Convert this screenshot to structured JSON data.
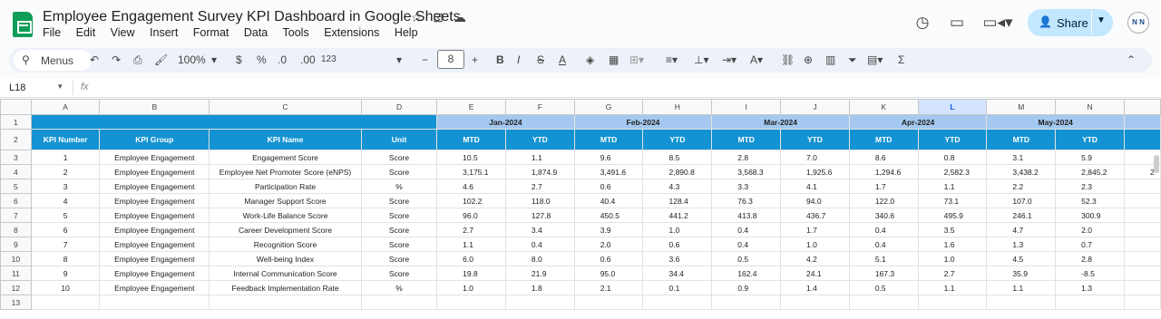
{
  "app": {
    "doc_title": "Employee Engagement Survey KPI Dashboard in Google Sheets",
    "menu": [
      "File",
      "Edit",
      "View",
      "Insert",
      "Format",
      "Data",
      "Tools",
      "Extensions",
      "Help"
    ],
    "share_label": "Share",
    "avatar_text": "N N"
  },
  "toolbar": {
    "search_label": "Menus",
    "zoom": "100%",
    "currency": "$",
    "percent": "%",
    "dec_less": ".0",
    "dec_more": ".00",
    "number_format": "123",
    "font_size": "8"
  },
  "formula_bar": {
    "cell_ref": "L18",
    "fx": "fx"
  },
  "grid": {
    "columns": [
      "A",
      "B",
      "C",
      "D",
      "E",
      "F",
      "G",
      "H",
      "I",
      "J",
      "K",
      "L",
      "M",
      "N"
    ],
    "selected_column": "L",
    "row_numbers": [
      "1",
      "2",
      "3",
      "4",
      "5",
      "6",
      "7",
      "8",
      "9",
      "10",
      "11",
      "12",
      "13"
    ],
    "months": [
      "Jan-2024",
      "Feb-2024",
      "Mar-2024",
      "Apr-2024",
      "May-2024"
    ],
    "headers": [
      "KPI Number",
      "KPI Group",
      "KPI Name",
      "Unit"
    ],
    "mtd": "MTD",
    "ytd": "YTD",
    "rows": [
      {
        "num": "1",
        "group": "Employee Engagement",
        "name": "Engagement Score",
        "unit": "Score",
        "vals": [
          "10.5",
          "1.1",
          "9.6",
          "8.5",
          "2.8",
          "7.0",
          "8.6",
          "0.8",
          "3.1",
          "5.9"
        ]
      },
      {
        "num": "2",
        "group": "Employee Engagement",
        "name": "Employee Net Promoter Score (eNPS)",
        "unit": "Score",
        "vals": [
          "3,175.1",
          "1,874.9",
          "3,491.6",
          "2,890.8",
          "3,568.3",
          "1,925.6",
          "1,294.6",
          "2,582.3",
          "3,438.2",
          "2,845.2"
        ]
      },
      {
        "num": "3",
        "group": "Employee Engagement",
        "name": "Participation Rate",
        "unit": "%",
        "vals": [
          "4.6",
          "2.7",
          "0.6",
          "4.3",
          "3.3",
          "4.1",
          "1.7",
          "1.1",
          "2.2",
          "2.3"
        ]
      },
      {
        "num": "4",
        "group": "Employee Engagement",
        "name": "Manager Support Score",
        "unit": "Score",
        "vals": [
          "102.2",
          "118.0",
          "40.4",
          "128.4",
          "76.3",
          "94.0",
          "122.0",
          "73.1",
          "107.0",
          "52.3"
        ]
      },
      {
        "num": "5",
        "group": "Employee Engagement",
        "name": "Work-Life Balance Score",
        "unit": "Score",
        "vals": [
          "96.0",
          "127.8",
          "450.5",
          "441.2",
          "413.8",
          "436.7",
          "340.6",
          "495.9",
          "246.1",
          "300.9"
        ]
      },
      {
        "num": "6",
        "group": "Employee Engagement",
        "name": "Career Development Score",
        "unit": "Score",
        "vals": [
          "2.7",
          "3.4",
          "3.9",
          "1.0",
          "0.4",
          "1.7",
          "0.4",
          "3.5",
          "4.7",
          "2.0"
        ]
      },
      {
        "num": "7",
        "group": "Employee Engagement",
        "name": "Recognition Score",
        "unit": "Score",
        "vals": [
          "1.1",
          "0.4",
          "2.0",
          "0.6",
          "0.4",
          "1.0",
          "0.4",
          "1.6",
          "1.3",
          "0.7"
        ]
      },
      {
        "num": "8",
        "group": "Employee Engagement",
        "name": "Well-being Index",
        "unit": "Score",
        "vals": [
          "6.0",
          "8.0",
          "0.6",
          "3.6",
          "0.5",
          "4.2",
          "5.1",
          "1.0",
          "4.5",
          "2.8"
        ]
      },
      {
        "num": "9",
        "group": "Employee Engagement",
        "name": "Internal Communication Score",
        "unit": "Score",
        "vals": [
          "19.8",
          "21.9",
          "95.0",
          "34.4",
          "162.4",
          "24.1",
          "167.3",
          "2.7",
          "35.9",
          "-8.5"
        ]
      },
      {
        "num": "10",
        "group": "Employee Engagement",
        "name": "Feedback Implementation Rate",
        "unit": "%",
        "vals": [
          "1.0",
          "1.8",
          "2.1",
          "0.1",
          "0.9",
          "1.4",
          "0.5",
          "1.1",
          "1.1",
          "1.3"
        ]
      }
    ],
    "overflow_cell": "2"
  }
}
